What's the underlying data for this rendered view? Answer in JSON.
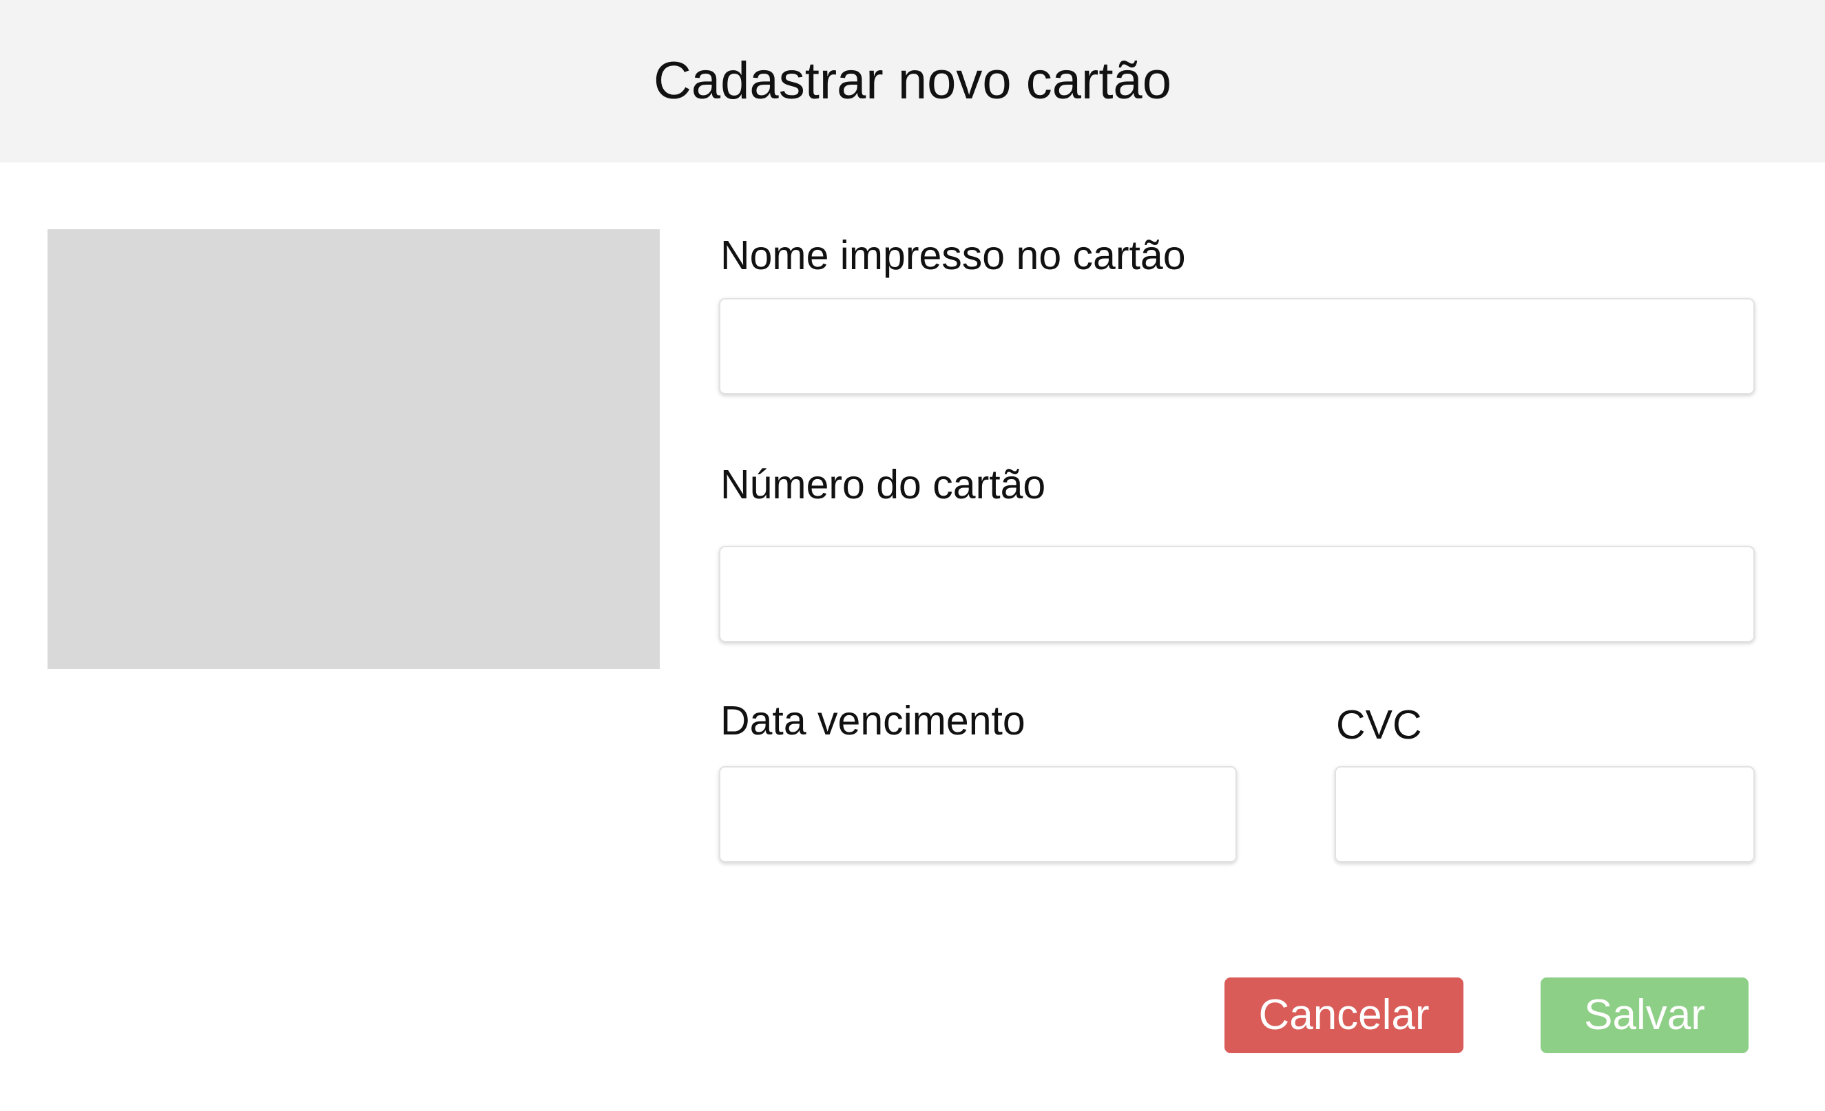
{
  "dialog": {
    "title": "Cadastrar novo cartão"
  },
  "form": {
    "name_label": "Nome impresso no cartão",
    "name_value": "",
    "number_label": "Número do cartão",
    "number_value": "",
    "expiry_label": "Data vencimento",
    "expiry_value": "",
    "cvc_label": "CVC",
    "cvc_value": ""
  },
  "actions": {
    "cancel_label": "Cancelar",
    "save_label": "Salvar"
  },
  "colors": {
    "header_bg": "#f3f3f3",
    "image_placeholder": "#d9d9d9",
    "cancel": "#d95c59",
    "save": "#8ecf87"
  }
}
